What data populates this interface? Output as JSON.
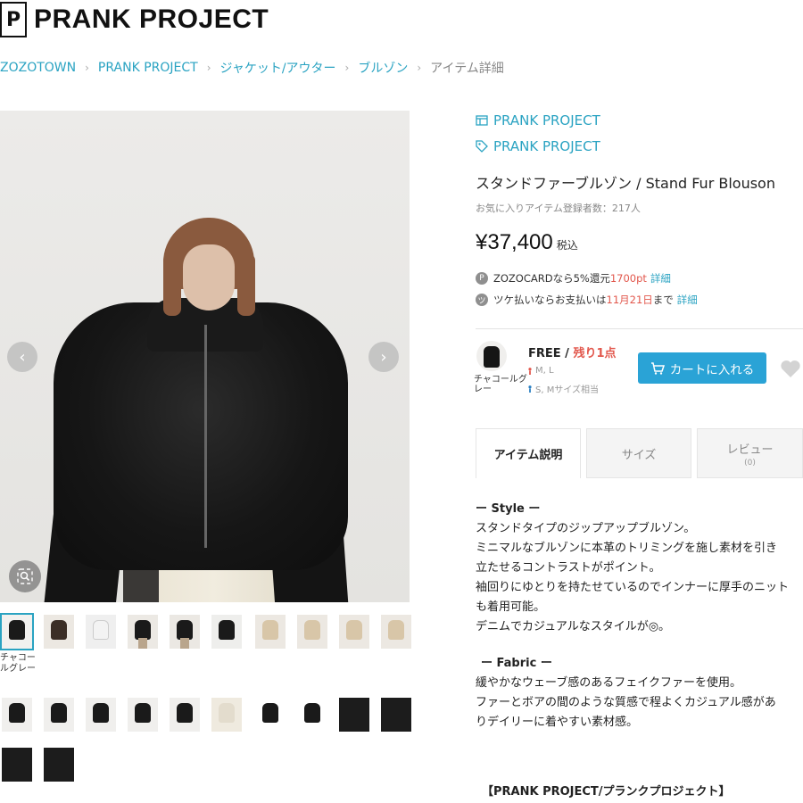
{
  "header": {
    "logo_glyph": "P",
    "brand_name": "PRANK PROJECT"
  },
  "breadcrumb": {
    "items": [
      "ZOZOTOWN",
      "PRANK PROJECT",
      "ジャケット/アウター",
      "ブルゾン",
      "アイテム詳細"
    ],
    "separator": "›"
  },
  "gallery": {
    "prev_glyph": "‹",
    "next_glyph": "›",
    "zoom_icon": "search-icon",
    "selected_caption": "チャコールグレー"
  },
  "product": {
    "brand_shop": "PRANK PROJECT",
    "brand_tag": "PRANK PROJECT",
    "title": "スタンドファーブルゾン / Stand Fur Blouson",
    "favorites": "お気に入りアイテム登録者数：217人",
    "price": "¥37,400",
    "tax_label": "税込",
    "zozocard_prefix": "ZOZOCARDなら5%還元",
    "zozocard_points": "1700pt",
    "details_link": "詳細",
    "tsuke_prefix": "ツケ払いならお支払いは",
    "tsuke_date": "11月21日",
    "tsuke_suffix": "まで",
    "info_icon1": "P",
    "info_icon2": "ツ"
  },
  "sku": {
    "color": "チャコールグレー",
    "size": "FREE / ",
    "stock": "残り1点",
    "fit_female": "M, L",
    "fit_male": "S, Mサイズ相当",
    "cart_label": "カートに入れる"
  },
  "tabs": [
    {
      "label": "アイテム説明",
      "sub": ""
    },
    {
      "label": "サイズ",
      "sub": ""
    },
    {
      "label": "レビュー",
      "sub": "(0)"
    }
  ],
  "description": {
    "style_head": "ー Style ー",
    "style_lines": [
      "スタンドタイプのジップアップブルゾン。",
      "ミニマルなブルゾンに本革のトリミングを施し素材を引き",
      "立たせるコントラストがポイント。",
      "袖回りにゆとりを持たせているのでインナーに厚手のニット",
      "も着用可能。",
      "デニムでカジュアルなスタイルが◎。"
    ],
    "fabric_head": "ー Fabric ー",
    "fabric_lines": [
      "緩やかなウェーブ感のあるフェイクファーを使用。",
      "ファーとボアの間のような質感で程よくカジュアル感があ",
      "りデイリーに着やすい素材感。"
    ],
    "footer": "【PRANK PROJECT/プランクプロジェクト】"
  },
  "colors": {
    "accent": "#2aa3c2",
    "cart": "#2aa3d6",
    "sale_red": "#e2574c"
  }
}
